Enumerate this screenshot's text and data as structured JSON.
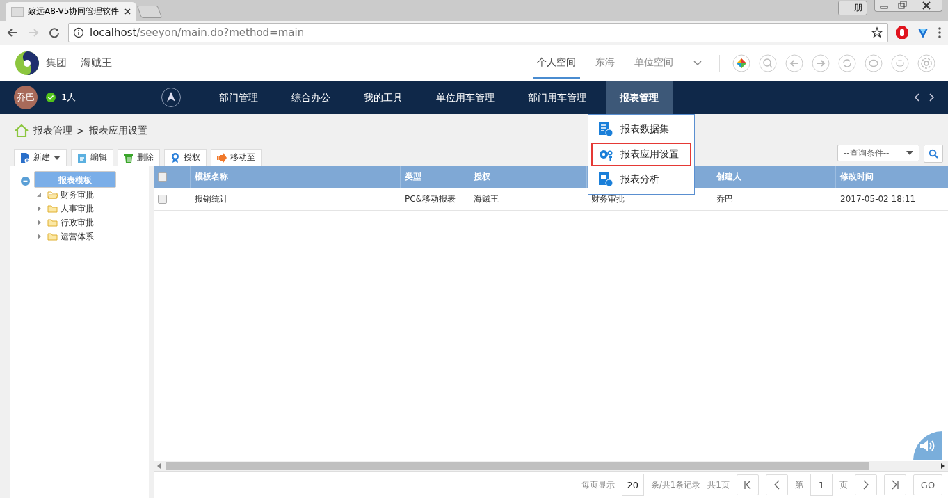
{
  "browser": {
    "tab_title": "致远A8-V5协同管理软件",
    "address": {
      "host": "localhost",
      "path": "/seeyon/main.do?method=main"
    },
    "ime_label": "朋"
  },
  "header": {
    "org": "集团",
    "company": "海贼王",
    "spaces": [
      {
        "label": "个人空间",
        "selected": true
      },
      {
        "label": "东海",
        "selected": false
      },
      {
        "label": "单位空间",
        "selected": false
      }
    ]
  },
  "navbar": {
    "avatar": "乔巴",
    "online_count": "1人",
    "items": [
      {
        "label": "部门管理",
        "selected": false
      },
      {
        "label": "综合办公",
        "selected": false
      },
      {
        "label": "我的工具",
        "selected": false
      },
      {
        "label": "单位用车管理",
        "selected": false
      },
      {
        "label": "部门用车管理",
        "selected": false
      },
      {
        "label": "报表管理",
        "selected": true
      }
    ]
  },
  "menu": [
    {
      "label": "报表数据集",
      "kind": "dataset",
      "selected": false
    },
    {
      "label": "报表应用设置",
      "kind": "gear",
      "selected": true
    },
    {
      "label": "报表分析",
      "kind": "analysis",
      "selected": false
    }
  ],
  "breadcrumb": [
    "报表管理",
    "报表应用设置"
  ],
  "breadcrumb_separator": ">",
  "toolbar": [
    {
      "label": "新建",
      "kind": "new",
      "dropdown": true
    },
    {
      "label": "编辑",
      "kind": "edit",
      "dropdown": false
    },
    {
      "label": "删除",
      "kind": "delete",
      "dropdown": false
    },
    {
      "label": "授权",
      "kind": "award",
      "dropdown": false
    },
    {
      "label": "移动至",
      "kind": "move",
      "dropdown": false
    }
  ],
  "search": {
    "placeholder": "--查询条件--"
  },
  "tree": {
    "label": "报表模板",
    "expanded": true,
    "selected": true,
    "children": [
      {
        "label": "财务审批",
        "expanded": true,
        "selected": false
      },
      {
        "label": "人事审批",
        "expanded": false,
        "selected": false
      },
      {
        "label": "行政审批",
        "expanded": false,
        "selected": false
      },
      {
        "label": "运营体系",
        "expanded": false,
        "selected": false
      }
    ]
  },
  "table": {
    "all_checked": false,
    "columns": [
      "模板名称",
      "类型",
      "授权",
      "",
      "创建人",
      "修改时间"
    ],
    "rows": [
      {
        "checked": false,
        "cells": [
          "报销统计",
          "PC&移动报表",
          "海贼王",
          "财务审批",
          "乔巴",
          "2017-05-02 18:11"
        ]
      }
    ]
  },
  "pager": {
    "per_page_label": "每页显示",
    "per_page": "20",
    "summary": "条/共1条记录",
    "pages": "共1页",
    "page_prefix": "第",
    "page": "1",
    "page_suffix": "页",
    "go": "GO"
  }
}
